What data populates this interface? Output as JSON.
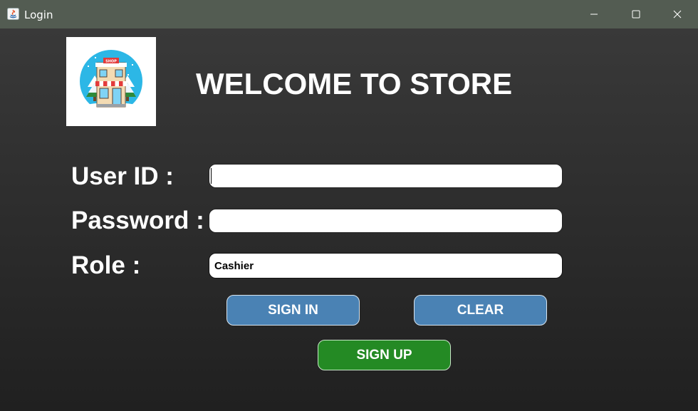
{
  "window": {
    "title": "Login",
    "titlebar_color": "#535c52"
  },
  "header": {
    "welcome_text": "WELCOME TO STORE",
    "logo_icon": "shop-storefront-icon",
    "logo_sign_text": "SHOP"
  },
  "form": {
    "user_id_label": "User ID :",
    "user_id_value": "",
    "password_label": "Password :",
    "password_value": "",
    "role_label": "Role :",
    "role_value": "Cashier"
  },
  "buttons": {
    "sign_in": "SIGN IN",
    "clear": "CLEAR",
    "sign_up": "SIGN UP"
  },
  "colors": {
    "primary_button": "#4a82b4",
    "signup_button": "#248a24"
  }
}
